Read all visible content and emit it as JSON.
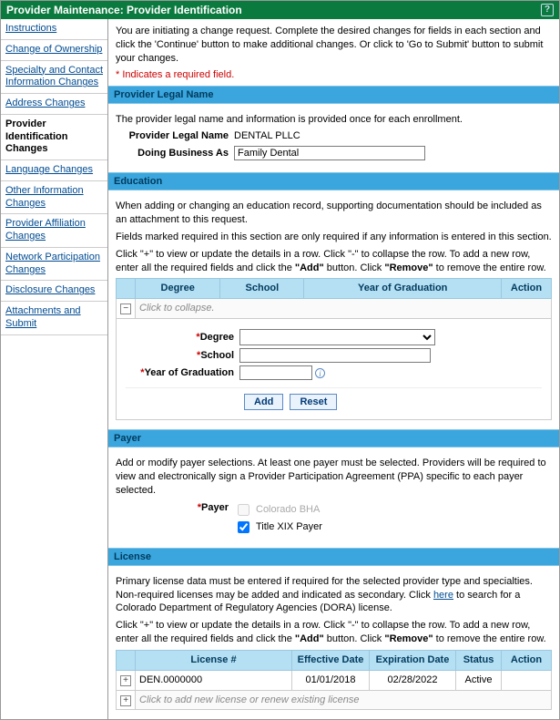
{
  "title": "Provider Maintenance: Provider Identification",
  "intro": "You are initiating a change request. Complete the desired changes for fields in each section and click the 'Continue' button to make additional changes. Or click to 'Go to Submit' button to submit your changes.",
  "required_note": "* Indicates a required field.",
  "sidebar": {
    "items": [
      {
        "label": "Instructions"
      },
      {
        "label": "Change of Ownership"
      },
      {
        "label": "Specialty and Contact Information Changes"
      },
      {
        "label": "Address Changes"
      },
      {
        "label": "Provider Identification Changes",
        "active": true
      },
      {
        "label": "Language Changes"
      },
      {
        "label": "Other Information Changes"
      },
      {
        "label": "Provider Affiliation Changes"
      },
      {
        "label": "Network Participation Changes"
      },
      {
        "label": "Disclosure Changes"
      },
      {
        "label": "Attachments and Submit"
      }
    ]
  },
  "legal": {
    "header": "Provider Legal Name",
    "note": "The provider legal name and information is provided once for each enrollment.",
    "name_label": "Provider Legal Name",
    "name_value": "DENTAL PLLC",
    "dba_label": "Doing Business As",
    "dba_value": "Family Dental"
  },
  "education": {
    "header": "Education",
    "p1": "When adding or changing an education record, supporting documentation should be included as an attachment to this request.",
    "p2": "Fields marked required in this section are only required if any information is entered in this section.",
    "p3a": "Click \"+\" to view or update the details in a row. Click \"-\" to collapse the row. To add a new row, enter all the required fields and click the ",
    "p3b": "\"Add\"",
    "p3c": " button. Click ",
    "p3d": "\"Remove\"",
    "p3e": " to remove the entire row.",
    "cols": [
      "Degree",
      "School",
      "Year of Graduation",
      "Action"
    ],
    "collapse_hint": "Click to collapse.",
    "form": {
      "degree_label": "Degree",
      "school_label": "School",
      "year_label": "Year of Graduation",
      "add": "Add",
      "reset": "Reset"
    }
  },
  "payer": {
    "header": "Payer",
    "note": "Add or modify payer selections. At least one payer must be selected. Providers will be required to view and electronically sign a Provider Participation Agreement (PPA) specific to each payer selected.",
    "label": "Payer",
    "opt1": "Colorado BHA",
    "opt2": "Title XIX Payer"
  },
  "license": {
    "header": "License",
    "p1a": "Primary license data must be entered if required for the selected provider type and specialties. Non-required licenses may be added and indicated as secondary. Click ",
    "p1b": "here",
    "p1c": " to search for a Colorado Department of Regulatory Agencies (DORA) license.",
    "p2a": "Click \"+\" to view or update the details in a row. Click \"-\" to collapse the row. To add a new row, enter all the required fields and click the ",
    "p2b": "\"Add\"",
    "p2c": " button. Click ",
    "p2d": "\"Remove\"",
    "p2e": " to remove the entire row.",
    "cols": [
      "License #",
      "Effective Date",
      "Expiration Date",
      "Status",
      "Action"
    ],
    "rows": [
      {
        "num": "DEN.0000000",
        "eff": "01/01/2018",
        "exp": "02/28/2022",
        "status": "Active"
      }
    ],
    "add_hint": "Click to add new license or renew existing license"
  }
}
